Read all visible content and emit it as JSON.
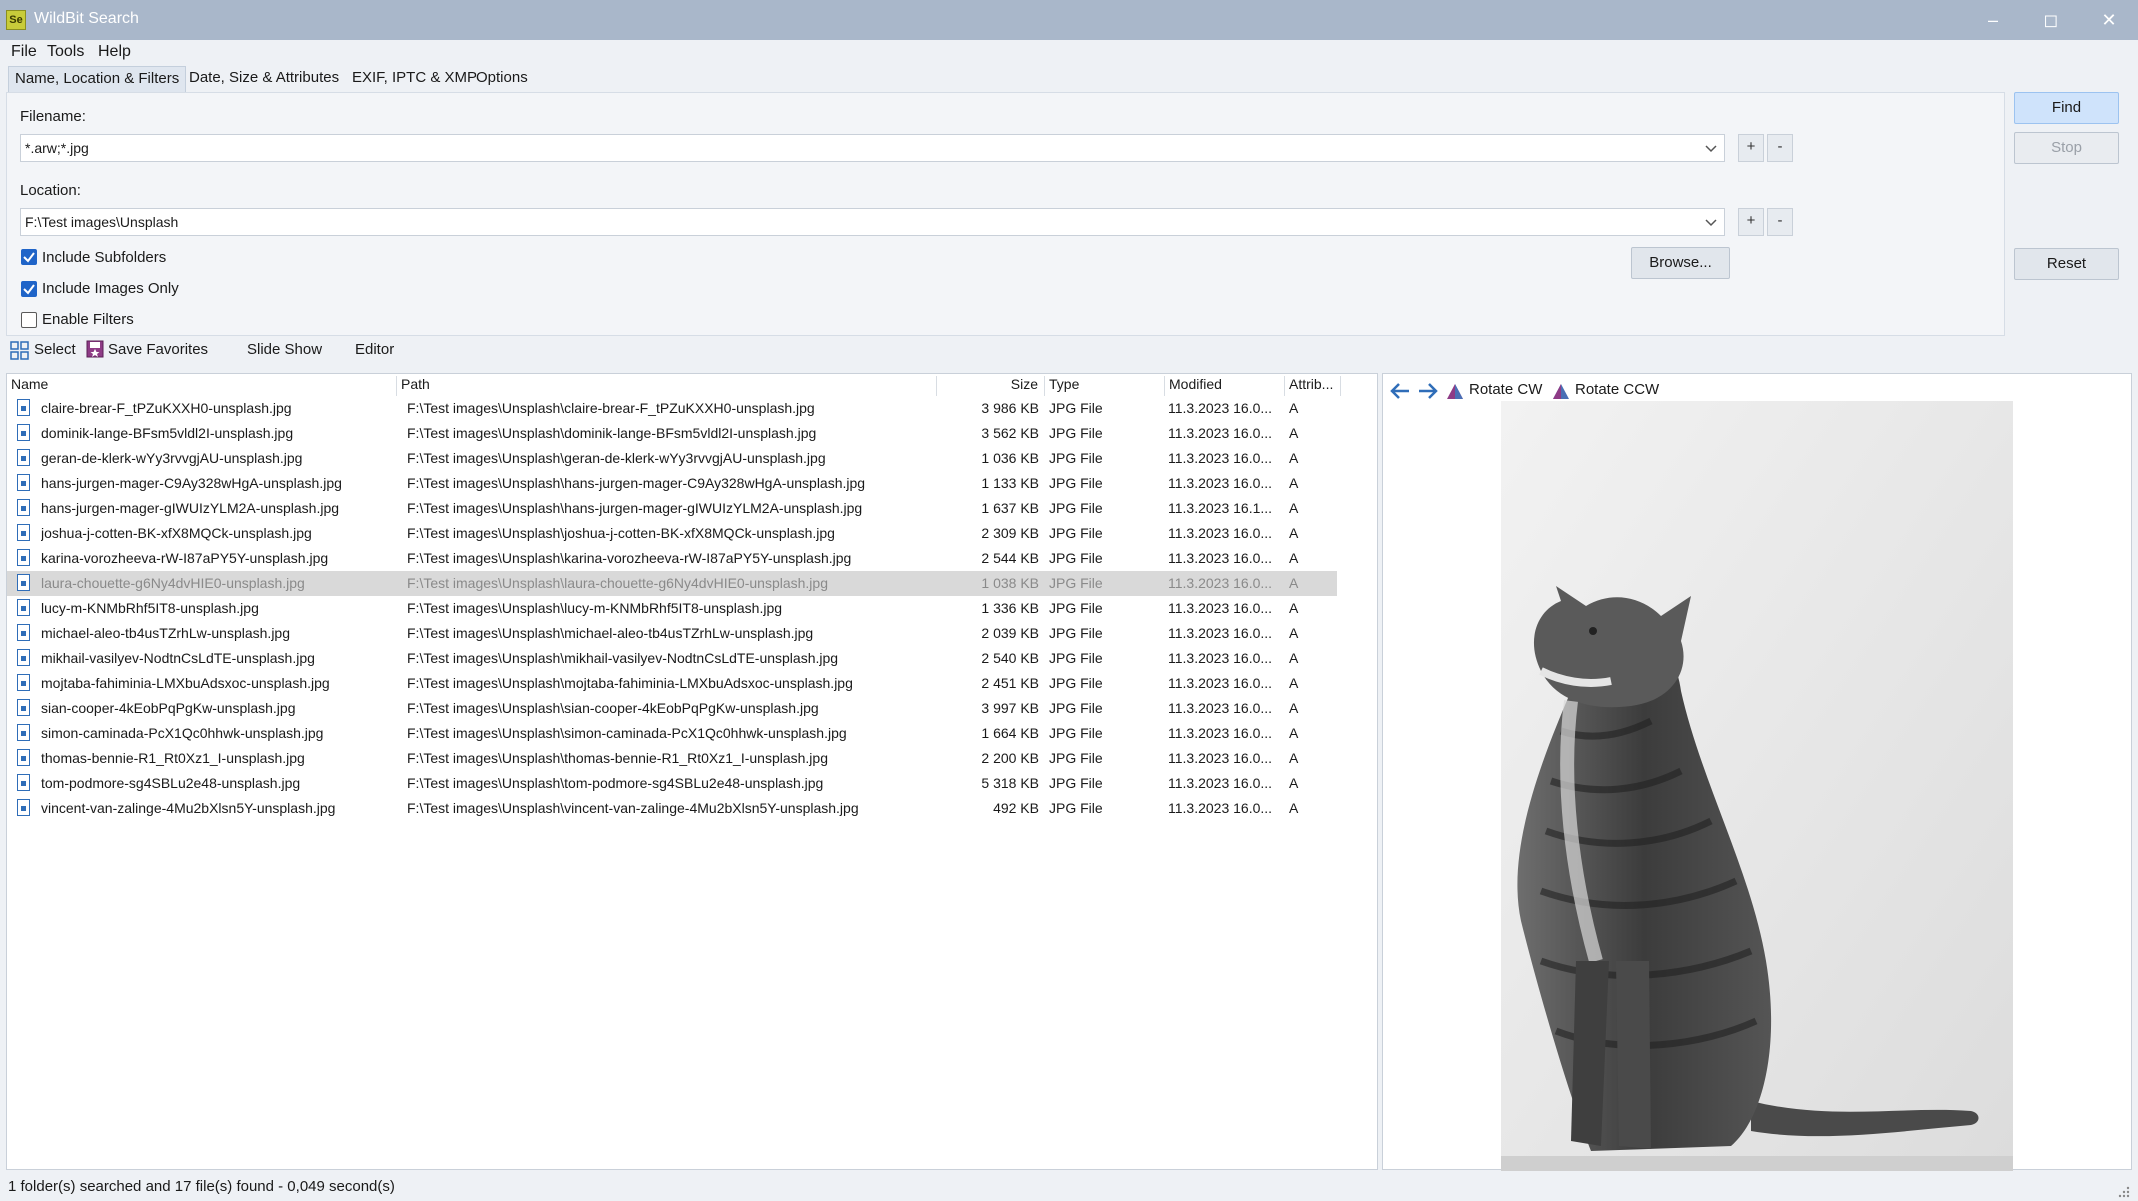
{
  "window": {
    "title": "WildBit Search",
    "icon_label": "Se"
  },
  "menu": [
    "File",
    "Tools",
    "Help"
  ],
  "tabs": [
    {
      "label": "Name, Location & Filters",
      "active": true
    },
    {
      "label": "Date, Size & Attributes",
      "active": false
    },
    {
      "label": "EXIF, IPTC & XMP",
      "active": false
    },
    {
      "label": "Options",
      "active": false
    }
  ],
  "filters": {
    "filename_label": "Filename:",
    "filename_value": "*.arw;*.jpg",
    "location_label": "Location:",
    "location_value": "F:\\Test images\\Unsplash",
    "plus": "+",
    "minus": "-",
    "include_subfolders": {
      "label": "Include Subfolders",
      "checked": true
    },
    "include_images_only": {
      "label": "Include Images Only",
      "checked": true
    },
    "enable_filters": {
      "label": "Enable Filters",
      "checked": false
    },
    "browse_label": "Browse..."
  },
  "actions": {
    "find": "Find",
    "stop": "Stop",
    "reset": "Reset"
  },
  "toolbar": {
    "select": "Select",
    "save_favorites": "Save Favorites",
    "slide_show": "Slide Show",
    "editor": "Editor"
  },
  "columns": {
    "name": "Name",
    "path": "Path",
    "size": "Size",
    "type": "Type",
    "modified": "Modified",
    "attrib": "Attrib..."
  },
  "files": [
    {
      "name": "claire-brear-F_tPZuKXXH0-unsplash.jpg",
      "path": "F:\\Test images\\Unsplash\\claire-brear-F_tPZuKXXH0-unsplash.jpg",
      "size": "3 986 KB",
      "type": "JPG File",
      "modified": "11.3.2023 16.0...",
      "attrib": "A"
    },
    {
      "name": "dominik-lange-BFsm5vldl2I-unsplash.jpg",
      "path": "F:\\Test images\\Unsplash\\dominik-lange-BFsm5vldl2I-unsplash.jpg",
      "size": "3 562 KB",
      "type": "JPG File",
      "modified": "11.3.2023 16.0...",
      "attrib": "A"
    },
    {
      "name": "geran-de-klerk-wYy3rvvgjAU-unsplash.jpg",
      "path": "F:\\Test images\\Unsplash\\geran-de-klerk-wYy3rvvgjAU-unsplash.jpg",
      "size": "1 036 KB",
      "type": "JPG File",
      "modified": "11.3.2023 16.0...",
      "attrib": "A"
    },
    {
      "name": "hans-jurgen-mager-C9Ay328wHgA-unsplash.jpg",
      "path": "F:\\Test images\\Unsplash\\hans-jurgen-mager-C9Ay328wHgA-unsplash.jpg",
      "size": "1 133 KB",
      "type": "JPG File",
      "modified": "11.3.2023 16.0...",
      "attrib": "A"
    },
    {
      "name": "hans-jurgen-mager-gIWUIzYLM2A-unsplash.jpg",
      "path": "F:\\Test images\\Unsplash\\hans-jurgen-mager-gIWUIzYLM2A-unsplash.jpg",
      "size": "1 637 KB",
      "type": "JPG File",
      "modified": "11.3.2023 16.1...",
      "attrib": "A"
    },
    {
      "name": "joshua-j-cotten-BK-xfX8MQCk-unsplash.jpg",
      "path": "F:\\Test images\\Unsplash\\joshua-j-cotten-BK-xfX8MQCk-unsplash.jpg",
      "size": "2 309 KB",
      "type": "JPG File",
      "modified": "11.3.2023 16.0...",
      "attrib": "A"
    },
    {
      "name": "karina-vorozheeva-rW-I87aPY5Y-unsplash.jpg",
      "path": "F:\\Test images\\Unsplash\\karina-vorozheeva-rW-I87aPY5Y-unsplash.jpg",
      "size": "2 544 KB",
      "type": "JPG File",
      "modified": "11.3.2023 16.0...",
      "attrib": "A"
    },
    {
      "name": "laura-chouette-g6Ny4dvHIE0-unsplash.jpg",
      "path": "F:\\Test images\\Unsplash\\laura-chouette-g6Ny4dvHIE0-unsplash.jpg",
      "size": "1 038 KB",
      "type": "JPG File",
      "modified": "11.3.2023 16.0...",
      "attrib": "A",
      "selected": true
    },
    {
      "name": "lucy-m-KNMbRhf5IT8-unsplash.jpg",
      "path": "F:\\Test images\\Unsplash\\lucy-m-KNMbRhf5IT8-unsplash.jpg",
      "size": "1 336 KB",
      "type": "JPG File",
      "modified": "11.3.2023 16.0...",
      "attrib": "A"
    },
    {
      "name": "michael-aleo-tb4usTZrhLw-unsplash.jpg",
      "path": "F:\\Test images\\Unsplash\\michael-aleo-tb4usTZrhLw-unsplash.jpg",
      "size": "2 039 KB",
      "type": "JPG File",
      "modified": "11.3.2023 16.0...",
      "attrib": "A"
    },
    {
      "name": "mikhail-vasilyev-NodtnCsLdTE-unsplash.jpg",
      "path": "F:\\Test images\\Unsplash\\mikhail-vasilyev-NodtnCsLdTE-unsplash.jpg",
      "size": "2 540 KB",
      "type": "JPG File",
      "modified": "11.3.2023 16.0...",
      "attrib": "A"
    },
    {
      "name": "mojtaba-fahiminia-LMXbuAdsxoc-unsplash.jpg",
      "path": "F:\\Test images\\Unsplash\\mojtaba-fahiminia-LMXbuAdsxoc-unsplash.jpg",
      "size": "2 451 KB",
      "type": "JPG File",
      "modified": "11.3.2023 16.0...",
      "attrib": "A"
    },
    {
      "name": "sian-cooper-4kEobPqPgKw-unsplash.jpg",
      "path": "F:\\Test images\\Unsplash\\sian-cooper-4kEobPqPgKw-unsplash.jpg",
      "size": "3 997 KB",
      "type": "JPG File",
      "modified": "11.3.2023 16.0...",
      "attrib": "A"
    },
    {
      "name": "simon-caminada-PcX1Qc0hhwk-unsplash.jpg",
      "path": "F:\\Test images\\Unsplash\\simon-caminada-PcX1Qc0hhwk-unsplash.jpg",
      "size": "1 664 KB",
      "type": "JPG File",
      "modified": "11.3.2023 16.0...",
      "attrib": "A"
    },
    {
      "name": "thomas-bennie-R1_Rt0Xz1_I-unsplash.jpg",
      "path": "F:\\Test images\\Unsplash\\thomas-bennie-R1_Rt0Xz1_I-unsplash.jpg",
      "size": "2 200 KB",
      "type": "JPG File",
      "modified": "11.3.2023 16.0...",
      "attrib": "A"
    },
    {
      "name": "tom-podmore-sg4SBLu2e48-unsplash.jpg",
      "path": "F:\\Test images\\Unsplash\\tom-podmore-sg4SBLu2e48-unsplash.jpg",
      "size": "5 318 KB",
      "type": "JPG File",
      "modified": "11.3.2023 16.0...",
      "attrib": "A"
    },
    {
      "name": "vincent-van-zalinge-4Mu2bXlsn5Y-unsplash.jpg",
      "path": "F:\\Test images\\Unsplash\\vincent-van-zalinge-4Mu2bXlsn5Y-unsplash.jpg",
      "size": "492 KB",
      "type": "JPG File",
      "modified": "11.3.2023 16.0...",
      "attrib": "A"
    }
  ],
  "preview": {
    "rotate_cw": "Rotate CW",
    "rotate_ccw": "Rotate CCW",
    "icons": [
      "arrow-left-icon",
      "arrow-right-icon",
      "rotate-cw-icon",
      "rotate-ccw-icon"
    ]
  },
  "status": {
    "text": "1 folder(s) searched and 17 file(s) found - 0,049 second(s)"
  },
  "colors": {
    "titlebar": "#a9b7ca",
    "accent": "#1f64c8",
    "selection": "#d9d9d9"
  }
}
